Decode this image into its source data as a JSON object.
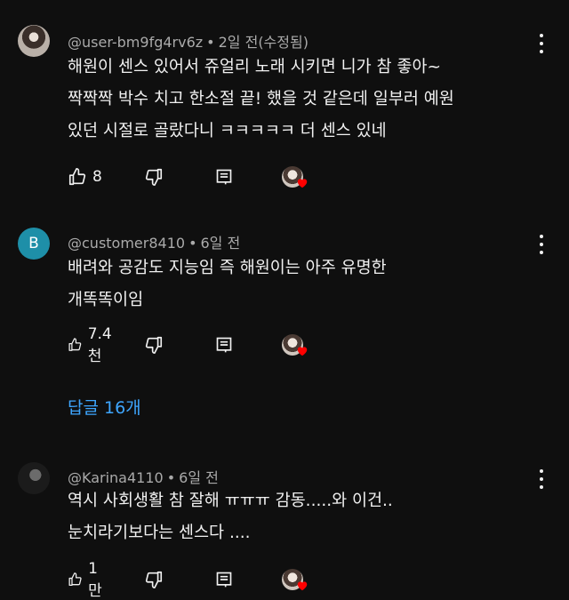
{
  "comments": [
    {
      "author": "@user-bm9fg4rv6z",
      "time": "2일 전(수정됨)",
      "text": "해원이 센스 있어서 쥬얼리 노래 시키면 니가 참 좋아~\n짝짝짝 박수 치고 한소절 끝! 했을 것 같은데 일부러 예원\n있던 시절로 골랐다니 ㅋㅋㅋㅋㅋ 더 센스 있네",
      "likes": "8",
      "avatar": "photo"
    },
    {
      "author": "@customer8410",
      "time": "6일 전",
      "text": "배려와 공감도 지능임 즉 해원이는 아주 유명한\n개똑똑이임",
      "likes": "7.4천",
      "avatar_letter": "B"
    },
    {
      "author": "@Karina4110",
      "time": "6일 전",
      "text": "역시 사회생활 참 잘해 ㅠㅠㅠ 감동.....와 이건..\n눈치라기보다는 센스다 ....",
      "likes": "1만",
      "avatar": "photo-dark"
    }
  ],
  "replies_label": "답글 16개",
  "colors": {
    "background": "#0f0f0f",
    "link": "#3ea6ff",
    "meta": "#aaaaaa",
    "heart": "#ff0000"
  },
  "icons": [
    "more-vert-icon",
    "thumb-up-icon",
    "thumb-down-icon",
    "reply-icon",
    "creator-heart-icon"
  ]
}
